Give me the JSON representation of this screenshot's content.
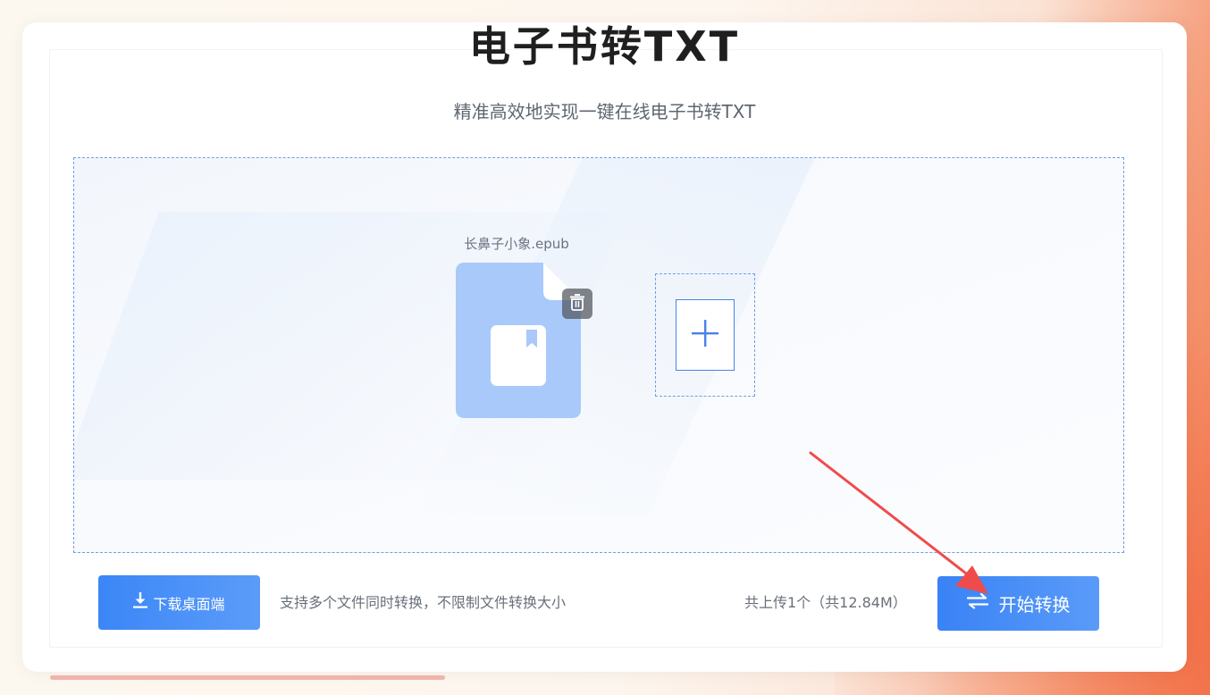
{
  "header": {
    "title": "电子书转TXT",
    "subtitle": "精准高效地实现一键在线电子书转TXT"
  },
  "upload": {
    "file": {
      "name": "长鼻子小象.epub",
      "icon": "ebook-file-icon",
      "delete_icon": "trash-icon"
    },
    "add_icon": "plus-icon"
  },
  "footer": {
    "download_label": "下载桌面端",
    "support_text": "支持多个文件同时转换，不限制文件转换大小",
    "count_text": "共上传1个（共12.84M）",
    "start_label": "开始转换"
  },
  "colors": {
    "accent": "#3b86f7",
    "file_card": "#a9c9fb",
    "annotation_arrow": "#f04b4b"
  }
}
